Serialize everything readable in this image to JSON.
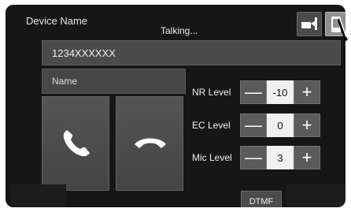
{
  "header": {
    "device_name": "Device Name",
    "status": "Talking...",
    "handset_icon": "handset-transfer-icon",
    "phone_icon": "phone-icon"
  },
  "call": {
    "number": "1234XXXXXX",
    "name": "Name",
    "call_icon": "call-icon",
    "end_icon": "end-call-icon"
  },
  "levels": [
    {
      "label": "NR Level",
      "value": "-10",
      "minus": "—",
      "plus": "+"
    },
    {
      "label": "EC Level",
      "value": "0",
      "minus": "—",
      "plus": "+"
    },
    {
      "label": "Mic Level",
      "value": "3",
      "minus": "—",
      "plus": "+"
    }
  ],
  "footer": {
    "dtmf_label": "DTMF"
  },
  "colors": {
    "background": "#161616",
    "button": "#555555",
    "value_box": "#f0f0f0"
  }
}
